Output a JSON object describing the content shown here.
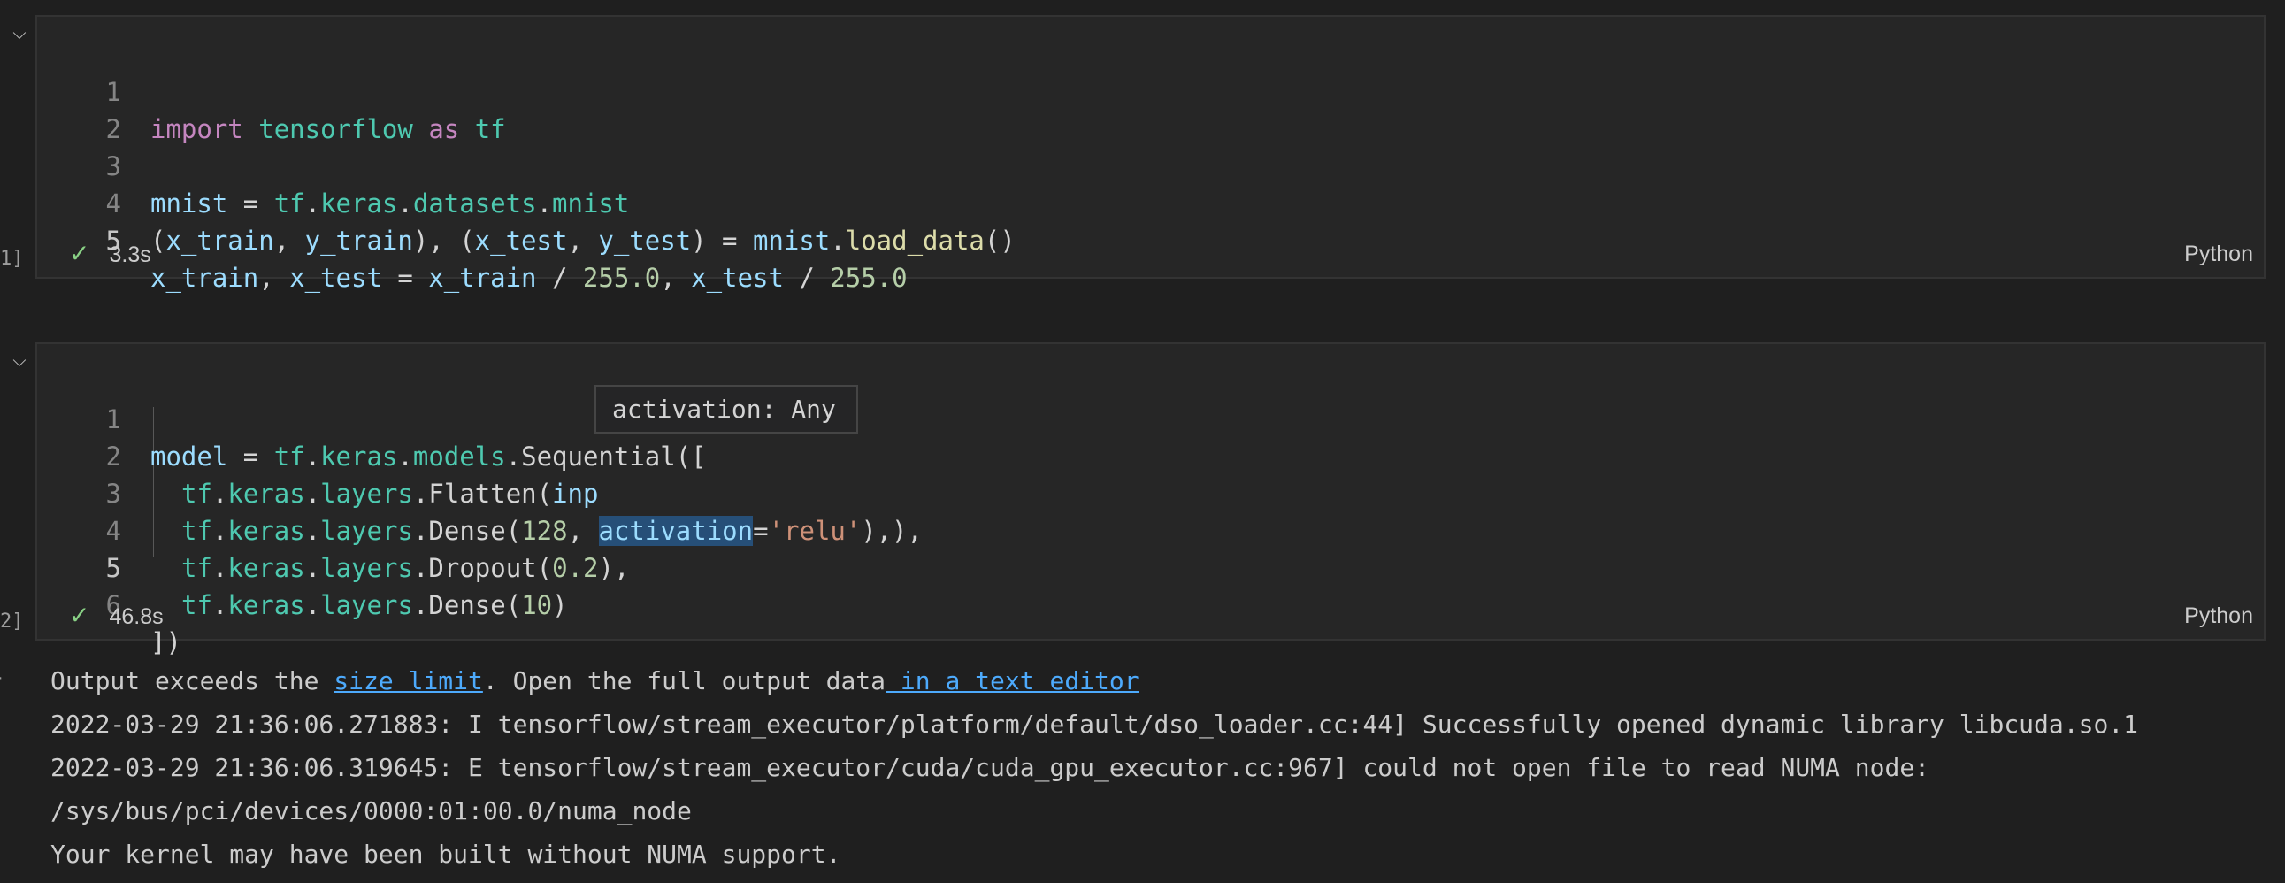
{
  "cell1": {
    "lines": [
      {
        "n": "1"
      },
      {
        "n": "2"
      },
      {
        "n": "3"
      },
      {
        "n": "4"
      },
      {
        "n": "5"
      }
    ],
    "code": {
      "l1_import": "import",
      "l1_mod": "tensorflow",
      "l1_as": "as",
      "l1_tf": "tf",
      "l3_mnist": "mnist",
      "l3_eq": " = ",
      "l3_tf": "tf",
      "l3_keras": "keras",
      "l3_datasets": "datasets",
      "l3_mnist2": "mnist",
      "l4_a": "(",
      "l4_xtrain": "x_train",
      "l4_b": ", ",
      "l4_ytrain": "y_train",
      "l4_c": "), (",
      "l4_xtest": "x_test",
      "l4_d": ", ",
      "l4_ytest": "y_test",
      "l4_e": ") = ",
      "l4_mnist": "mnist",
      "l4_f": ".",
      "l4_load": "load_data",
      "l4_g": "()",
      "l5_xtrain": "x_train",
      "l5_a": ", ",
      "l5_xtest": "x_test",
      "l5_b": " = ",
      "l5_xtrain2": "x_train",
      "l5_c": " / ",
      "l5_n1": "255.0",
      "l5_d": ", ",
      "l5_xtest2": "x_test",
      "l5_e": " / ",
      "l5_n2": "255.0"
    },
    "status": {
      "time": "3.3s",
      "language": "Python",
      "exec_count": "1]"
    }
  },
  "cell2": {
    "lines": [
      {
        "n": "1"
      },
      {
        "n": "2"
      },
      {
        "n": "3"
      },
      {
        "n": "4"
      },
      {
        "n": "5"
      },
      {
        "n": "6"
      }
    ],
    "code": {
      "l1_model": "model",
      "l1_eq": " = ",
      "l1_tf": "tf",
      "l1_keras": "keras",
      "l1_models": "models",
      "l1_seq": "Sequential",
      "l1_end": "([",
      "l2_tf": "tf",
      "l2_keras": "keras",
      "l2_layers": "layers",
      "l2_fn": "Flatten",
      "l2_a": "(",
      "l2_inp": "inp",
      "l2_end": "),",
      "l3_tf": "tf",
      "l3_keras": "keras",
      "l3_layers": "layers",
      "l3_fn": "Dense",
      "l3_a": "(",
      "l3_n": "128",
      "l3_b": ", ",
      "l3_act": "activation",
      "l3_c": "=",
      "l3_s": "'relu'",
      "l3_end": "),",
      "l4_tf": "tf",
      "l4_keras": "keras",
      "l4_layers": "layers",
      "l4_fn": "Dropout",
      "l4_a": "(",
      "l4_n": "0.2",
      "l4_end": "),",
      "l5_tf": "tf",
      "l5_keras": "keras",
      "l5_layers": "layers",
      "l5_fn": "Dense",
      "l5_a": "(",
      "l5_n": "10",
      "l5_end": ")",
      "l6": "])"
    },
    "status": {
      "time": "46.8s",
      "language": "Python",
      "exec_count": "2]"
    },
    "hover": "activation: Any"
  },
  "output": {
    "line1_prefix": "Output exceeds the ",
    "line1_link1": "size limit",
    "line1_mid": ". Open the full output data",
    "line1_link2": " in a text editor",
    "line2": "2022-03-29 21:36:06.271883: I tensorflow/stream_executor/platform/default/dso_loader.cc:44] Successfully opened dynamic library libcuda.so.1",
    "line3": "2022-03-29 21:36:06.319645: E tensorflow/stream_executor/cuda/cuda_gpu_executor.cc:967] could not open file to read NUMA node:",
    "line4": "/sys/bus/pci/devices/0000:01:00.0/numa_node",
    "line5": "Your kernel may have been built without NUMA support."
  },
  "icons": {
    "collapse": "chevron-down-icon",
    "check": "check-icon"
  }
}
